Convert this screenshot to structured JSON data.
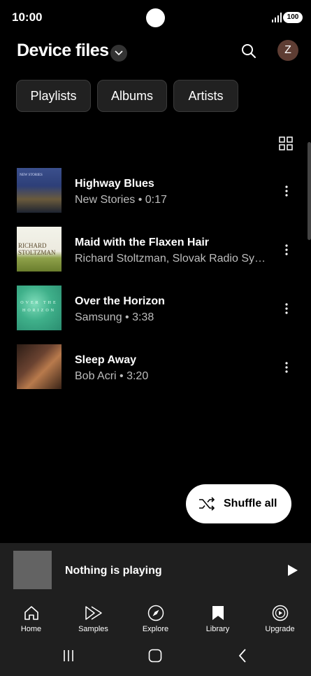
{
  "status": {
    "time": "10:00",
    "battery": "100"
  },
  "header": {
    "title": "Device files",
    "avatar_initial": "Z"
  },
  "chips": [
    {
      "label": "Playlists"
    },
    {
      "label": "Albums"
    },
    {
      "label": "Artists"
    }
  ],
  "tracks": [
    {
      "title": "Highway Blues",
      "subtitle": "New Stories • 0:17",
      "cover_text": "NEW STORIES"
    },
    {
      "title": "Maid with the Flaxen Hair",
      "subtitle": "Richard Stoltzman, Slovak Radio Sym…",
      "cover_text": "RICHARD STOLTZMAN"
    },
    {
      "title": "Over the Horizon",
      "subtitle": "Samsung • 3:38",
      "cover_text": "OVER THE HORIZON"
    },
    {
      "title": "Sleep Away",
      "subtitle": "Bob Acri • 3:20",
      "cover_text": ""
    }
  ],
  "shuffle": {
    "label": "Shuffle all"
  },
  "mini_player": {
    "title": "Nothing is playing"
  },
  "bottom_nav": [
    {
      "label": "Home",
      "icon": "home-icon"
    },
    {
      "label": "Samples",
      "icon": "samples-icon"
    },
    {
      "label": "Explore",
      "icon": "compass-icon"
    },
    {
      "label": "Library",
      "icon": "bookmark-icon"
    },
    {
      "label": "Upgrade",
      "icon": "upgrade-icon"
    }
  ],
  "system_nav": {
    "recents_icon": "recents-icon",
    "home_icon": "home-button-icon",
    "back_icon": "back-icon"
  }
}
